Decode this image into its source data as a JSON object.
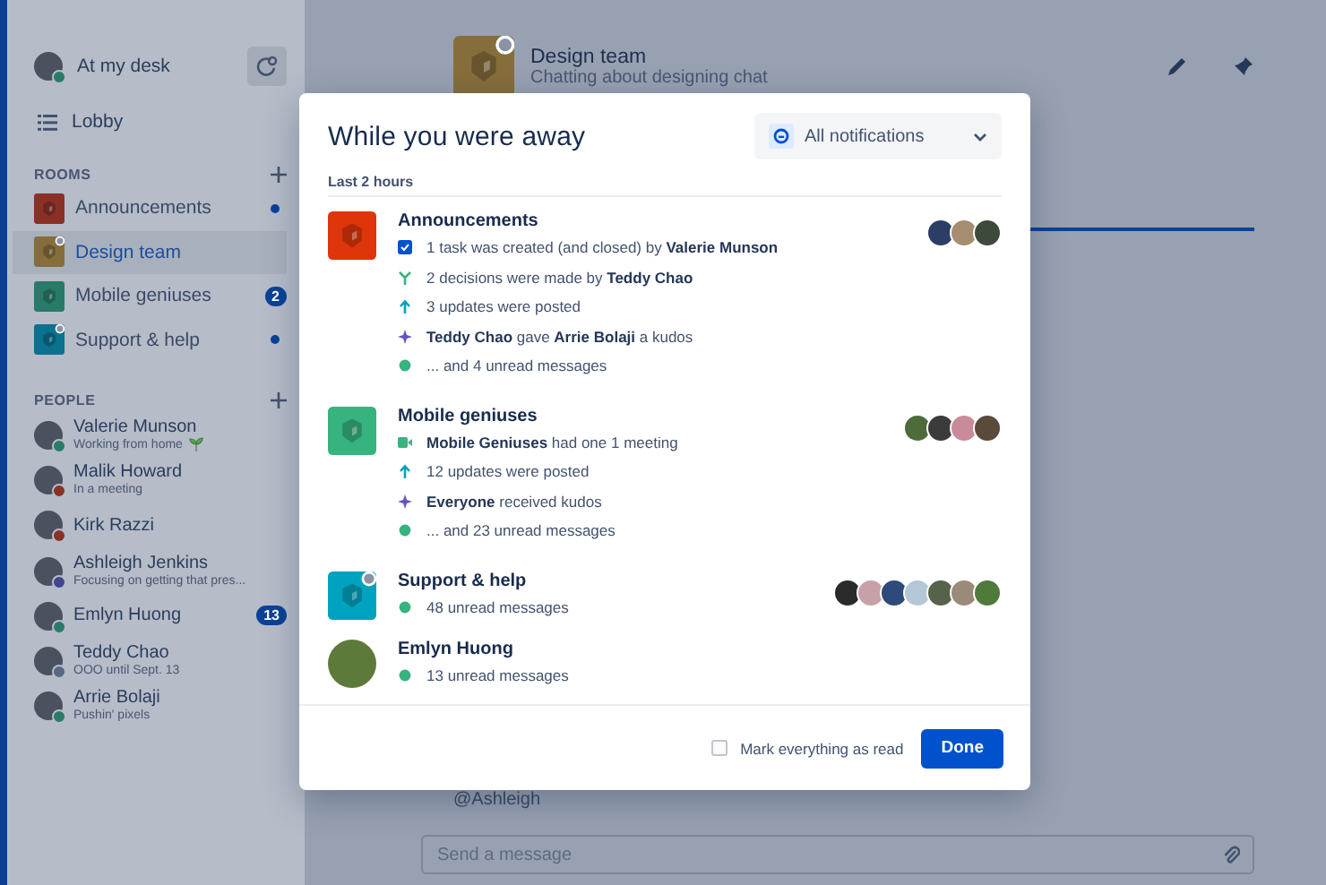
{
  "sidebar": {
    "status": {
      "label": "At my desk",
      "color": "#297a69"
    },
    "lobby": "Lobby",
    "rooms_heading": "ROOMS",
    "rooms": [
      {
        "name": "Announcements",
        "color": "#8a3127",
        "badge": false,
        "selected": false,
        "unread": {
          "kind": "dot"
        }
      },
      {
        "name": "Design team",
        "color": "#866e3b",
        "badge": true,
        "selected": true
      },
      {
        "name": "Mobile geniuses",
        "color": "#297a69",
        "badge": false,
        "selected": false,
        "unread": {
          "kind": "count",
          "text": "2"
        }
      },
      {
        "name": "Support & help",
        "color": "#0a718f",
        "badge": true,
        "selected": false,
        "unread": {
          "kind": "dot"
        }
      }
    ],
    "people_heading": "PEOPLE",
    "people": [
      {
        "name": "Valerie Munson",
        "status": "Working from home",
        "emoji": true,
        "color": "#297a69"
      },
      {
        "name": "Malik Howard",
        "status": "In a meeting",
        "color": "#8a3127"
      },
      {
        "name": "Kirk Razzi",
        "color": "#8a3127"
      },
      {
        "name": "Ashleigh Jenkins",
        "status": "Focusing on getting that pres...",
        "color": "#444390"
      },
      {
        "name": "Emlyn Huong",
        "color": "#297a69",
        "unread": "13"
      },
      {
        "name": "Teddy Chao",
        "status": "OOO until Sept. 13",
        "color": "#59677f"
      },
      {
        "name": "Arrie Bolaji",
        "status": "Pushin' pixels",
        "color": "#297a69"
      }
    ]
  },
  "main": {
    "room": {
      "name": "Design team",
      "topic": "Chatting about designing chat",
      "color": "#866e3b",
      "badge": true
    },
    "mention": "@Ashleigh",
    "composer": {
      "placeholder": "Send a message"
    }
  },
  "modal": {
    "title": "While you were away",
    "filter": "All notifications",
    "section": "Last 2 hours",
    "groups": [
      {
        "kind": "room",
        "name": "Announcements",
        "color": "#de350b",
        "badge": false,
        "lines": [
          {
            "kind": "task",
            "text": "1 task was created (and closed) by **Valerie Munson**"
          },
          {
            "kind": "decision",
            "text": "2 decisions were made by **Teddy Chao**"
          },
          {
            "kind": "update",
            "text": "3 updates were posted"
          },
          {
            "kind": "kudos",
            "text": "**Teddy Chao** gave **Arrie Bolaji** a kudos"
          },
          {
            "kind": "message",
            "text": "... and 4 unread messages"
          }
        ],
        "participants": [
          {
            "color": "#2c3e66"
          },
          {
            "color": "#a58d6f"
          },
          {
            "color": "#3d4a3a"
          }
        ]
      },
      {
        "kind": "room",
        "name": "Mobile geniuses",
        "color": "#36b37e",
        "badge": false,
        "lines": [
          {
            "kind": "meeting",
            "text": "**Mobile Geniuses** had one 1 meeting"
          },
          {
            "kind": "update",
            "text": "12 updates were posted"
          },
          {
            "kind": "kudos",
            "text": "**Everyone** received kudos"
          },
          {
            "kind": "message",
            "text": "... and 23 unread messages"
          }
        ],
        "participants": [
          {
            "color": "#4f6b3c"
          },
          {
            "color": "#3b3b3b"
          },
          {
            "color": "#c98a9a"
          },
          {
            "color": "#5a4a3a"
          }
        ]
      },
      {
        "kind": "room",
        "name": "Support & help",
        "color": "#00a3bf",
        "badge": true,
        "lines": [
          {
            "kind": "message",
            "text": "48 unread messages"
          }
        ],
        "participants": [
          {
            "color": "#2b2b2b"
          },
          {
            "color": "#c7a0a8"
          },
          {
            "color": "#2c4a7a"
          },
          {
            "color": "#b5c6d6"
          },
          {
            "color": "#56634a"
          },
          {
            "color": "#9a8a7a"
          },
          {
            "color": "#4f7a3c"
          }
        ]
      },
      {
        "kind": "person",
        "name": "Emlyn Huong",
        "color": "#5d7a3a",
        "lines": [
          {
            "kind": "message",
            "text": "13 unread messages"
          }
        ]
      }
    ],
    "mark_all": {
      "label": "Mark everything as read",
      "checked": false
    },
    "done": "Done"
  }
}
